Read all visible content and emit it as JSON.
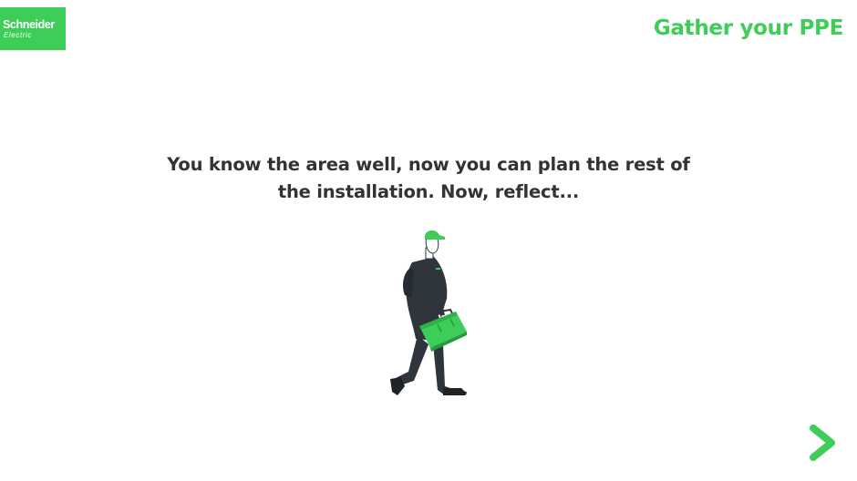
{
  "brand": {
    "logo_line1": "Schneider",
    "logo_line2": "Electric",
    "accent_color": "#3dcd58"
  },
  "header": {
    "title": "Gather your PPE"
  },
  "main": {
    "message": "You know the area well, now you can plan the rest of the installation. Now, reflect..."
  },
  "illustration": {
    "subject": "worker-with-toolbox",
    "icon": "worker-icon"
  },
  "navigation": {
    "next_icon": "chevron-right-icon"
  }
}
